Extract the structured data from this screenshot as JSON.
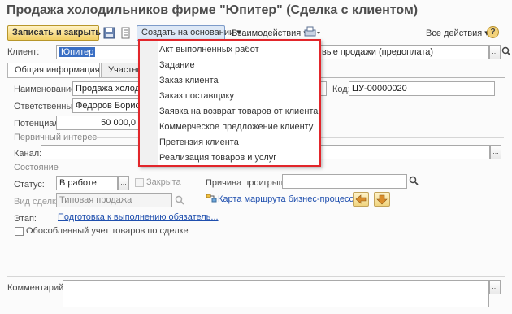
{
  "window": {
    "title": "Продажа холодильников фирме \"Юпитер\" (Сделка с клиентом)"
  },
  "toolbar": {
    "save_close": "Записать и закрыть",
    "create_based": "Создать на основании",
    "interaction": "Взаимодействия",
    "all_actions": "Все действия",
    "help": "?",
    "dropdown_glyph": "▾"
  },
  "client": {
    "label": "Клиент:",
    "value": "Юпитер",
    "sales_type": "вые продажи (предоплата)"
  },
  "tabs": [
    {
      "label": "Общая информация"
    },
    {
      "label": "Участни"
    }
  ],
  "general": {
    "name_label": "Наименование:",
    "name_value": "Продажа холодил",
    "code_label": "Код:",
    "code_value": "ЦУ-00000020",
    "responsible_label": "Ответственный:",
    "responsible_value": "Федоров Борис М",
    "potential_label": "Потенциал:",
    "potential_value": "50 000,0"
  },
  "primary_interest": {
    "header": "Первичный интерес",
    "channel_label": "Канал:"
  },
  "state": {
    "header": "Состояние",
    "status_label": "Статус:",
    "status_value": "В работе",
    "closed_label": "Закрыта",
    "loss_reason_label": "Причина проигрыша:",
    "deal_type_label": "Вид сделки:",
    "deal_type_value": "Типовая продажа",
    "route_map_link": "Карта маршрута бизнес-процесса",
    "stage_label": "Этап:",
    "stage_link": "Подготовка к выполнению обязатель...",
    "separate_accounting_label": "Обособленный учет товаров по сделке"
  },
  "comment": {
    "label": "Комментарий:"
  },
  "create_menu": {
    "items": [
      "Акт выполненных работ",
      "Задание",
      "Заказ клиента",
      "Заказ поставщику",
      "Заявка на возврат товаров от клиента",
      "Коммерческое предложение клиенту",
      "Претензия клиента",
      "Реализация товаров и услуг"
    ]
  },
  "colors": {
    "menu_border": "#e2262b",
    "link": "#1f4fae",
    "primary_button": "#f2cf63"
  }
}
